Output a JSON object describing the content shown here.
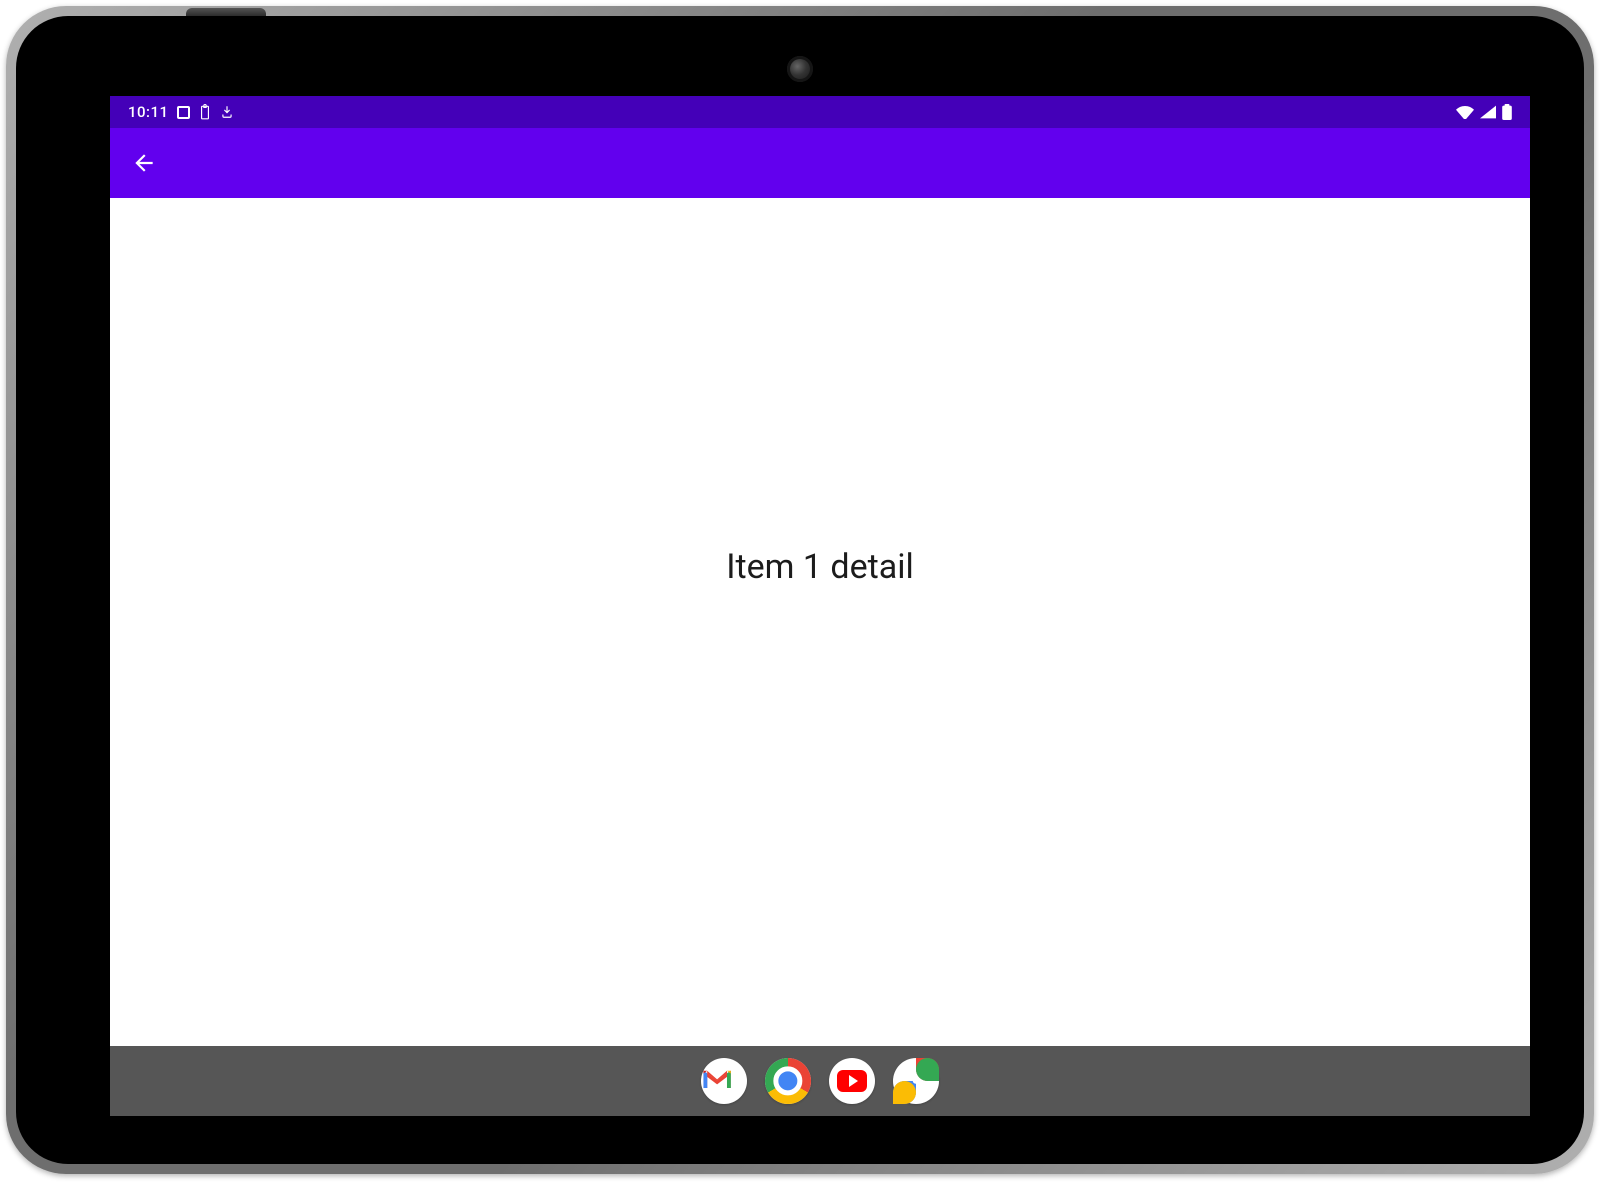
{
  "status": {
    "time": "10:11"
  },
  "appbar": {
    "back_label": "Back"
  },
  "content": {
    "detail_text": "Item 1 detail"
  },
  "taskbar": {
    "apps": {
      "gmail": "Gmail",
      "chrome": "Chrome",
      "youtube": "YouTube",
      "photos": "Photos"
    }
  },
  "colors": {
    "status_bar": "#4400b8",
    "app_bar": "#6200ee",
    "taskbar": "#565656"
  }
}
